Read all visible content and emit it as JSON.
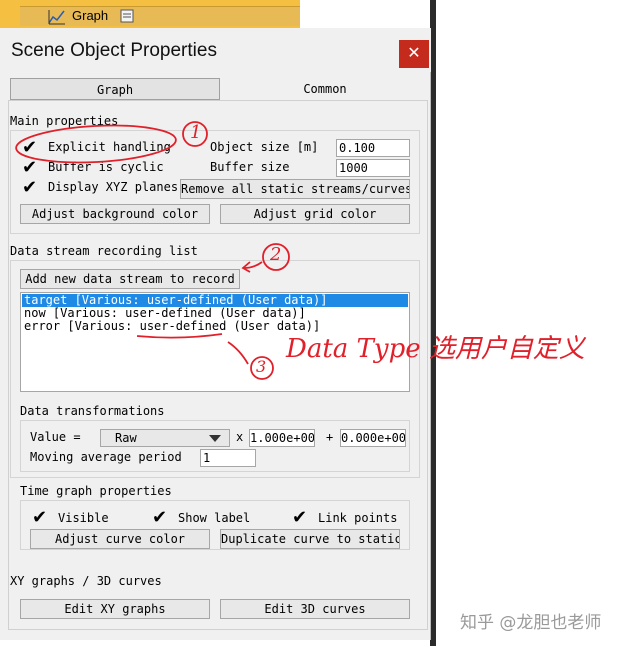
{
  "top_tree": {
    "label": "Graph"
  },
  "dialog": {
    "title": "Scene Object Properties",
    "close_symbol": "✕",
    "tabs": [
      {
        "label": "Graph"
      },
      {
        "label": "Common"
      }
    ]
  },
  "main_properties": {
    "heading": "Main properties",
    "explicit_handling": "Explicit handling",
    "buffer_cyclic": "Buffer is cyclic",
    "display_xyz": "Display XYZ planes",
    "object_size_label": "Object size [m]",
    "object_size_value": "0.100",
    "buffer_size_label": "Buffer size",
    "buffer_size_value": "1000",
    "remove_streams": "Remove all static streams/curves",
    "adjust_bg": "Adjust background color",
    "adjust_grid": "Adjust grid color"
  },
  "recording": {
    "heading": "Data stream recording list",
    "add_button": "Add new data stream to record",
    "items": [
      "target [Various: user-defined (User data)]",
      "now [Various: user-defined (User data)]",
      "error [Various: user-defined (User data)]"
    ]
  },
  "transformations": {
    "heading": "Data transformations",
    "value_label": "Value =",
    "value_select": "Raw",
    "times": "x",
    "factor": "1.000e+00",
    "plus": "+",
    "offset": "0.000e+00",
    "moving_label": "Moving average period",
    "moving_value": "1"
  },
  "time_graph": {
    "heading": "Time graph properties",
    "visible": "Visible",
    "show_label": "Show label",
    "link_points": "Link points",
    "adjust_curve": "Adjust curve color",
    "duplicate": "Duplicate curve to static"
  },
  "xy": {
    "heading": "XY graphs / 3D curves",
    "edit_xy": "Edit XY graphs",
    "edit_3d": "Edit 3D curves"
  },
  "annotations": {
    "n1": "1",
    "n2": "2",
    "n3": "3",
    "note": "Data Type 选用户自定义"
  },
  "watermark": "知乎 @龙胆也老师",
  "colors": {
    "close": "#c42b1c",
    "selection": "#1e8ae6",
    "annotation": "#e0202a",
    "tree_bar": "#f5c042"
  }
}
